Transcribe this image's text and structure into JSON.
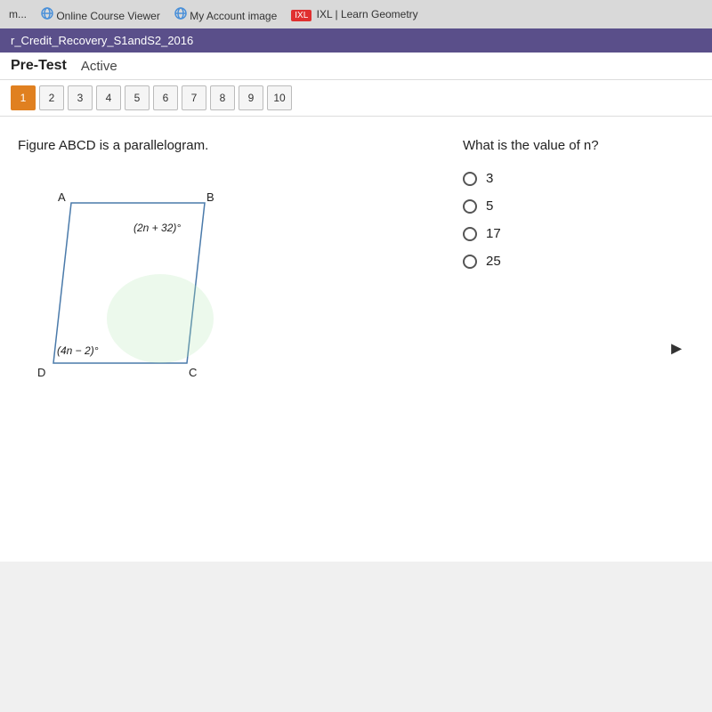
{
  "browser": {
    "tabs": [
      {
        "label": "m..."
      },
      {
        "label": "Online Course Viewer"
      },
      {
        "label": "My Account image"
      },
      {
        "label": "IXL | Learn Geometry"
      }
    ]
  },
  "header": {
    "page_path": "r_Credit_Recovery_S1andS2_2016"
  },
  "pretest": {
    "label": "Pre-Test",
    "status": "Active"
  },
  "question_tabs": {
    "tabs": [
      "1",
      "2",
      "3",
      "4",
      "5",
      "6",
      "7",
      "8",
      "9",
      "10"
    ],
    "active_index": 0
  },
  "figure": {
    "title": "Figure ABCD is a parallelogram.",
    "angle_b": "(2n + 32)°",
    "angle_d": "(4n − 2)°",
    "vertices": {
      "A": "A",
      "B": "B",
      "C": "C",
      "D": "D"
    }
  },
  "question": {
    "text": "What is the value of n?",
    "options": [
      "3",
      "5",
      "17",
      "25"
    ]
  }
}
